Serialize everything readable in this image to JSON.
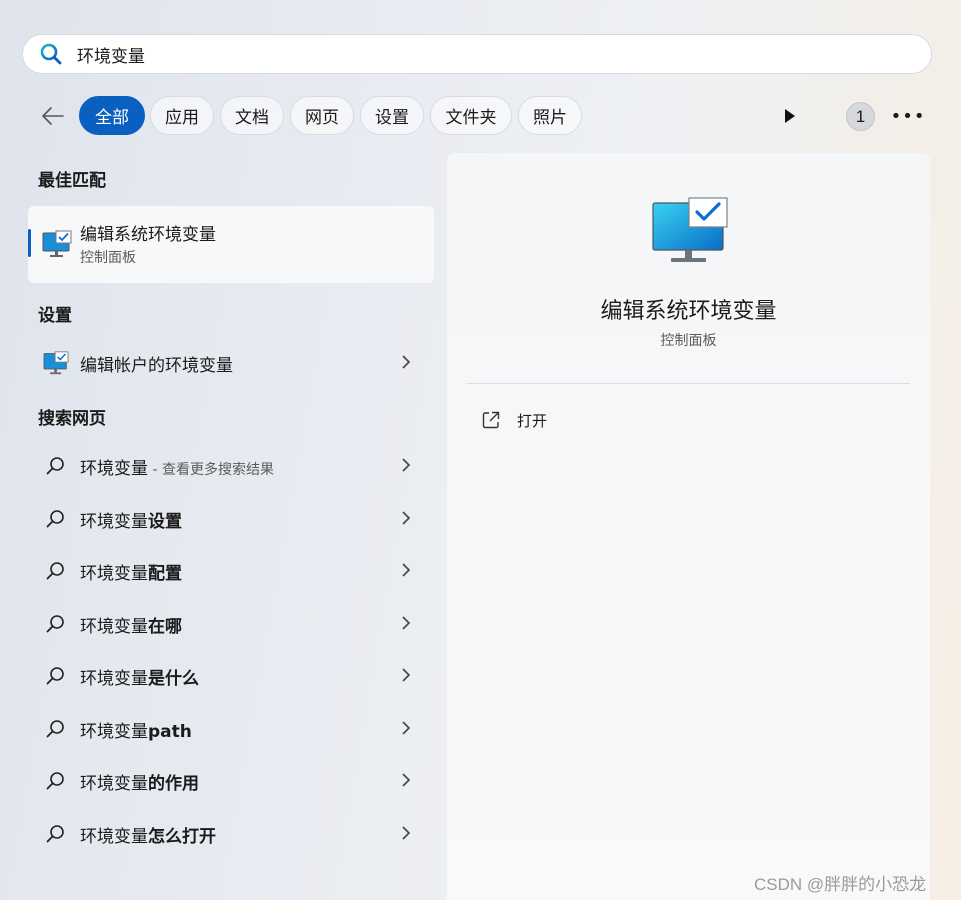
{
  "search": {
    "value": "环境变量"
  },
  "filters": {
    "chips": [
      "全部",
      "应用",
      "文档",
      "网页",
      "设置",
      "文件夹",
      "照片"
    ],
    "badge": "1"
  },
  "left": {
    "best_match_title": "最佳匹配",
    "best_match": {
      "title": "编辑系统环境变量",
      "subtitle": "控制面板"
    },
    "settings_title": "设置",
    "settings_item": "编辑帐户的环境变量",
    "web_title": "搜索网页",
    "web_items": [
      {
        "base": "环境变量",
        "bold": "",
        "sub": " - 查看更多搜索结果"
      },
      {
        "base": "环境变量",
        "bold": "设置",
        "sub": ""
      },
      {
        "base": "环境变量",
        "bold": "配置",
        "sub": ""
      },
      {
        "base": "环境变量",
        "bold": "在哪",
        "sub": ""
      },
      {
        "base": "环境变量",
        "bold": "是什么",
        "sub": ""
      },
      {
        "base": "环境变量",
        "bold": "path",
        "sub": ""
      },
      {
        "base": "环境变量",
        "bold": "的作用",
        "sub": ""
      },
      {
        "base": "环境变量",
        "bold": "怎么打开",
        "sub": ""
      }
    ]
  },
  "right": {
    "title": "编辑系统环境变量",
    "subtitle": "控制面板",
    "open_label": "打开"
  },
  "watermark": "CSDN @胖胖的小恐龙",
  "colors": {
    "accent": "#0a5fc1"
  }
}
